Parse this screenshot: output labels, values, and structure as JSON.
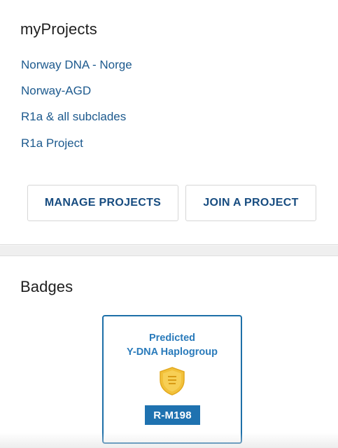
{
  "projects": {
    "title": "myProjects",
    "items": [
      {
        "label": "Norway DNA - Norge"
      },
      {
        "label": "Norway-AGD"
      },
      {
        "label": "R1a & all subclades"
      },
      {
        "label": "R1a Project"
      }
    ],
    "manage_label": "MANAGE PROJECTS",
    "join_label": "JOIN A PROJECT"
  },
  "badges": {
    "title": "Badges",
    "badge": {
      "title_line1": "Predicted",
      "title_line2": "Y-DNA Haplogroup",
      "icon": "shield-icon",
      "value": "R-M198"
    }
  },
  "colors": {
    "link": "#1d5a8e",
    "button_text": "#174c80",
    "badge_accent": "#1f72b0",
    "shield_gold": "#f2c13a"
  }
}
